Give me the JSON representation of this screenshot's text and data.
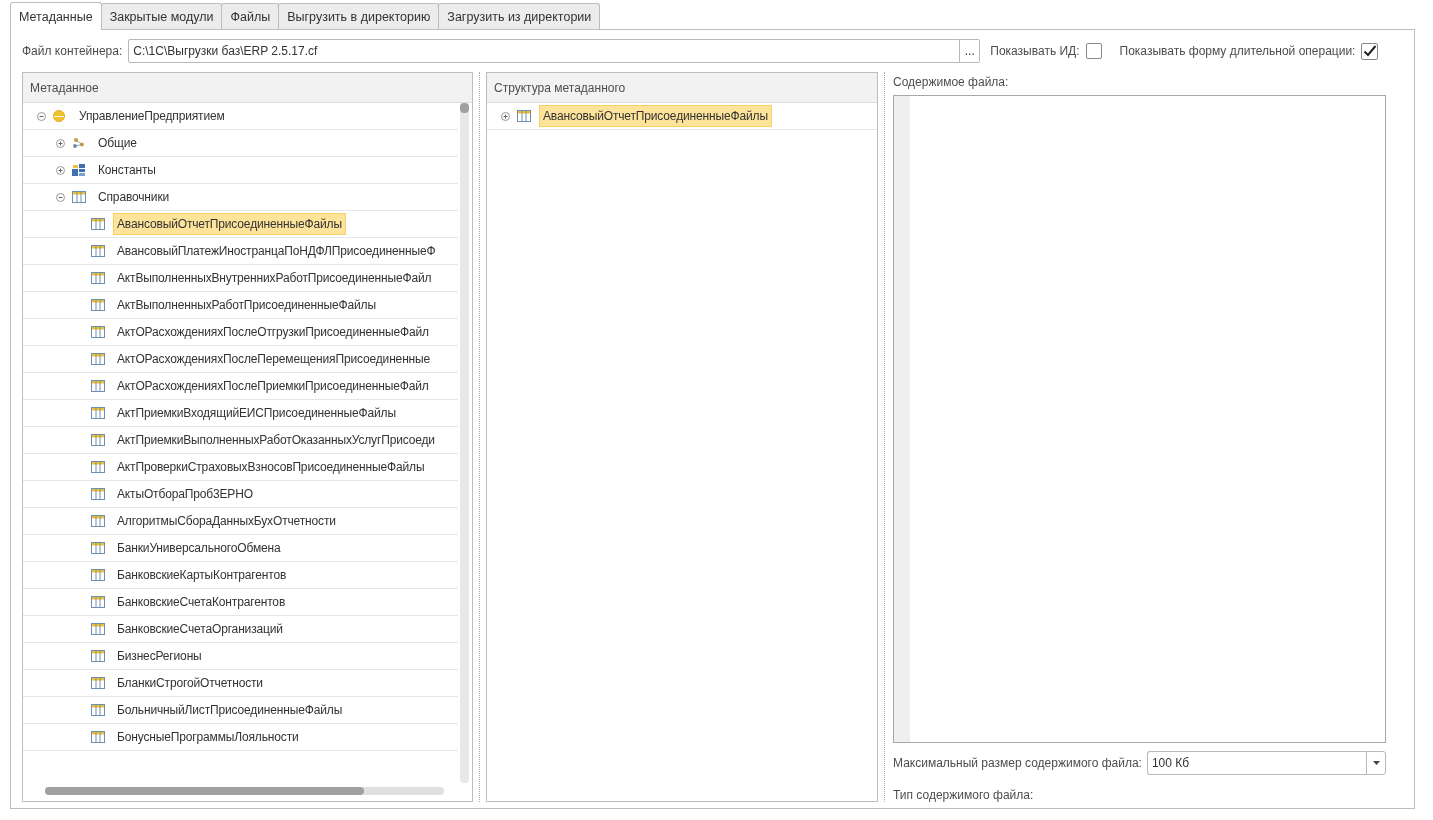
{
  "tabs": [
    {
      "label": "Метаданные",
      "selected": true
    },
    {
      "label": "Закрытые модули",
      "selected": false
    },
    {
      "label": "Файлы",
      "selected": false
    },
    {
      "label": "Выгрузить в директорию",
      "selected": false
    },
    {
      "label": "Загрузить из директории",
      "selected": false
    }
  ],
  "container_file": {
    "label": "Файл контейнера:",
    "value": "C:\\1C\\Выгрузки баз\\ERP 2.5.17.cf",
    "button": "..."
  },
  "options": [
    {
      "label": "Показывать ИД:",
      "checked": false
    },
    {
      "label": "Показывать форму длительной операции:",
      "checked": true
    }
  ],
  "metadata_tree": {
    "column": "Метаданное",
    "items": [
      {
        "label": "УправлениеПредприятием",
        "kind": "configuration",
        "expanded": true,
        "selected": false,
        "children": [
          {
            "label": "Общие",
            "kind": "common",
            "expanded": false,
            "selected": false
          },
          {
            "label": "Константы",
            "kind": "constants",
            "expanded": false,
            "selected": false
          },
          {
            "label": "Справочники",
            "kind": "catalog",
            "expanded": true,
            "selected": false,
            "children": [
              {
                "label": "АвансовыйОтчетПрисоединенныеФайлы",
                "kind": "catalog",
                "selected": true
              },
              {
                "label": "АвансовыйПлатежИностранцаПоНДФЛПрисоединенныеФ",
                "kind": "catalog",
                "selected": false
              },
              {
                "label": "АктВыполненныхВнутреннихРаботПрисоединенныеФайл",
                "kind": "catalog",
                "selected": false
              },
              {
                "label": "АктВыполненныхРаботПрисоединенныеФайлы",
                "kind": "catalog",
                "selected": false
              },
              {
                "label": "АктОРасхожденияхПослеОтгрузкиПрисоединенныеФайл",
                "kind": "catalog",
                "selected": false
              },
              {
                "label": "АктОРасхожденияхПослеПеремещенияПрисоединенные",
                "kind": "catalog",
                "selected": false
              },
              {
                "label": "АктОРасхожденияхПослеПриемкиПрисоединенныеФайл",
                "kind": "catalog",
                "selected": false
              },
              {
                "label": "АктПриемкиВходящийЕИСПрисоединенныеФайлы",
                "kind": "catalog",
                "selected": false
              },
              {
                "label": "АктПриемкиВыполненныхРаботОказанныхУслугПрисоеди",
                "kind": "catalog",
                "selected": false
              },
              {
                "label": "АктПроверкиСтраховыхВзносовПрисоединенныеФайлы",
                "kind": "catalog",
                "selected": false
              },
              {
                "label": "АктыОтбораПроб3ЕРНО",
                "kind": "catalog",
                "selected": false
              },
              {
                "label": "АлгоритмыСбораДанныхБухОтчетности",
                "kind": "catalog",
                "selected": false
              },
              {
                "label": "БанкиУниверсальногоОбмена",
                "kind": "catalog",
                "selected": false
              },
              {
                "label": "БанковскиеКартыКонтрагентов",
                "kind": "catalog",
                "selected": false
              },
              {
                "label": "БанковскиеСчетаКонтрагентов",
                "kind": "catalog",
                "selected": false
              },
              {
                "label": "БанковскиеСчетаОрганизаций",
                "kind": "catalog",
                "selected": false
              },
              {
                "label": "БизнесРегионы",
                "kind": "catalog",
                "selected": false
              },
              {
                "label": "БланкиСтрогойОтчетности",
                "kind": "catalog",
                "selected": false
              },
              {
                "label": "БольничныйЛистПрисоединенныеФайлы",
                "kind": "catalog",
                "selected": false
              },
              {
                "label": "БонусныеПрограммыЛояльности",
                "kind": "catalog",
                "selected": false
              }
            ]
          }
        ]
      }
    ]
  },
  "structure_tree": {
    "column": "Структура метаданного",
    "items": [
      {
        "label": "АвансовыйОтчетПрисоединенныеФайлы",
        "kind": "catalog",
        "expanded": false,
        "selected": true
      }
    ]
  },
  "file_content": {
    "label": "Содержимое файла:"
  },
  "max_size": {
    "label": "Максимальный размер содержимого файла:",
    "value": "100 Кб"
  },
  "content_type": {
    "label": "Тип содержимого файла:"
  }
}
